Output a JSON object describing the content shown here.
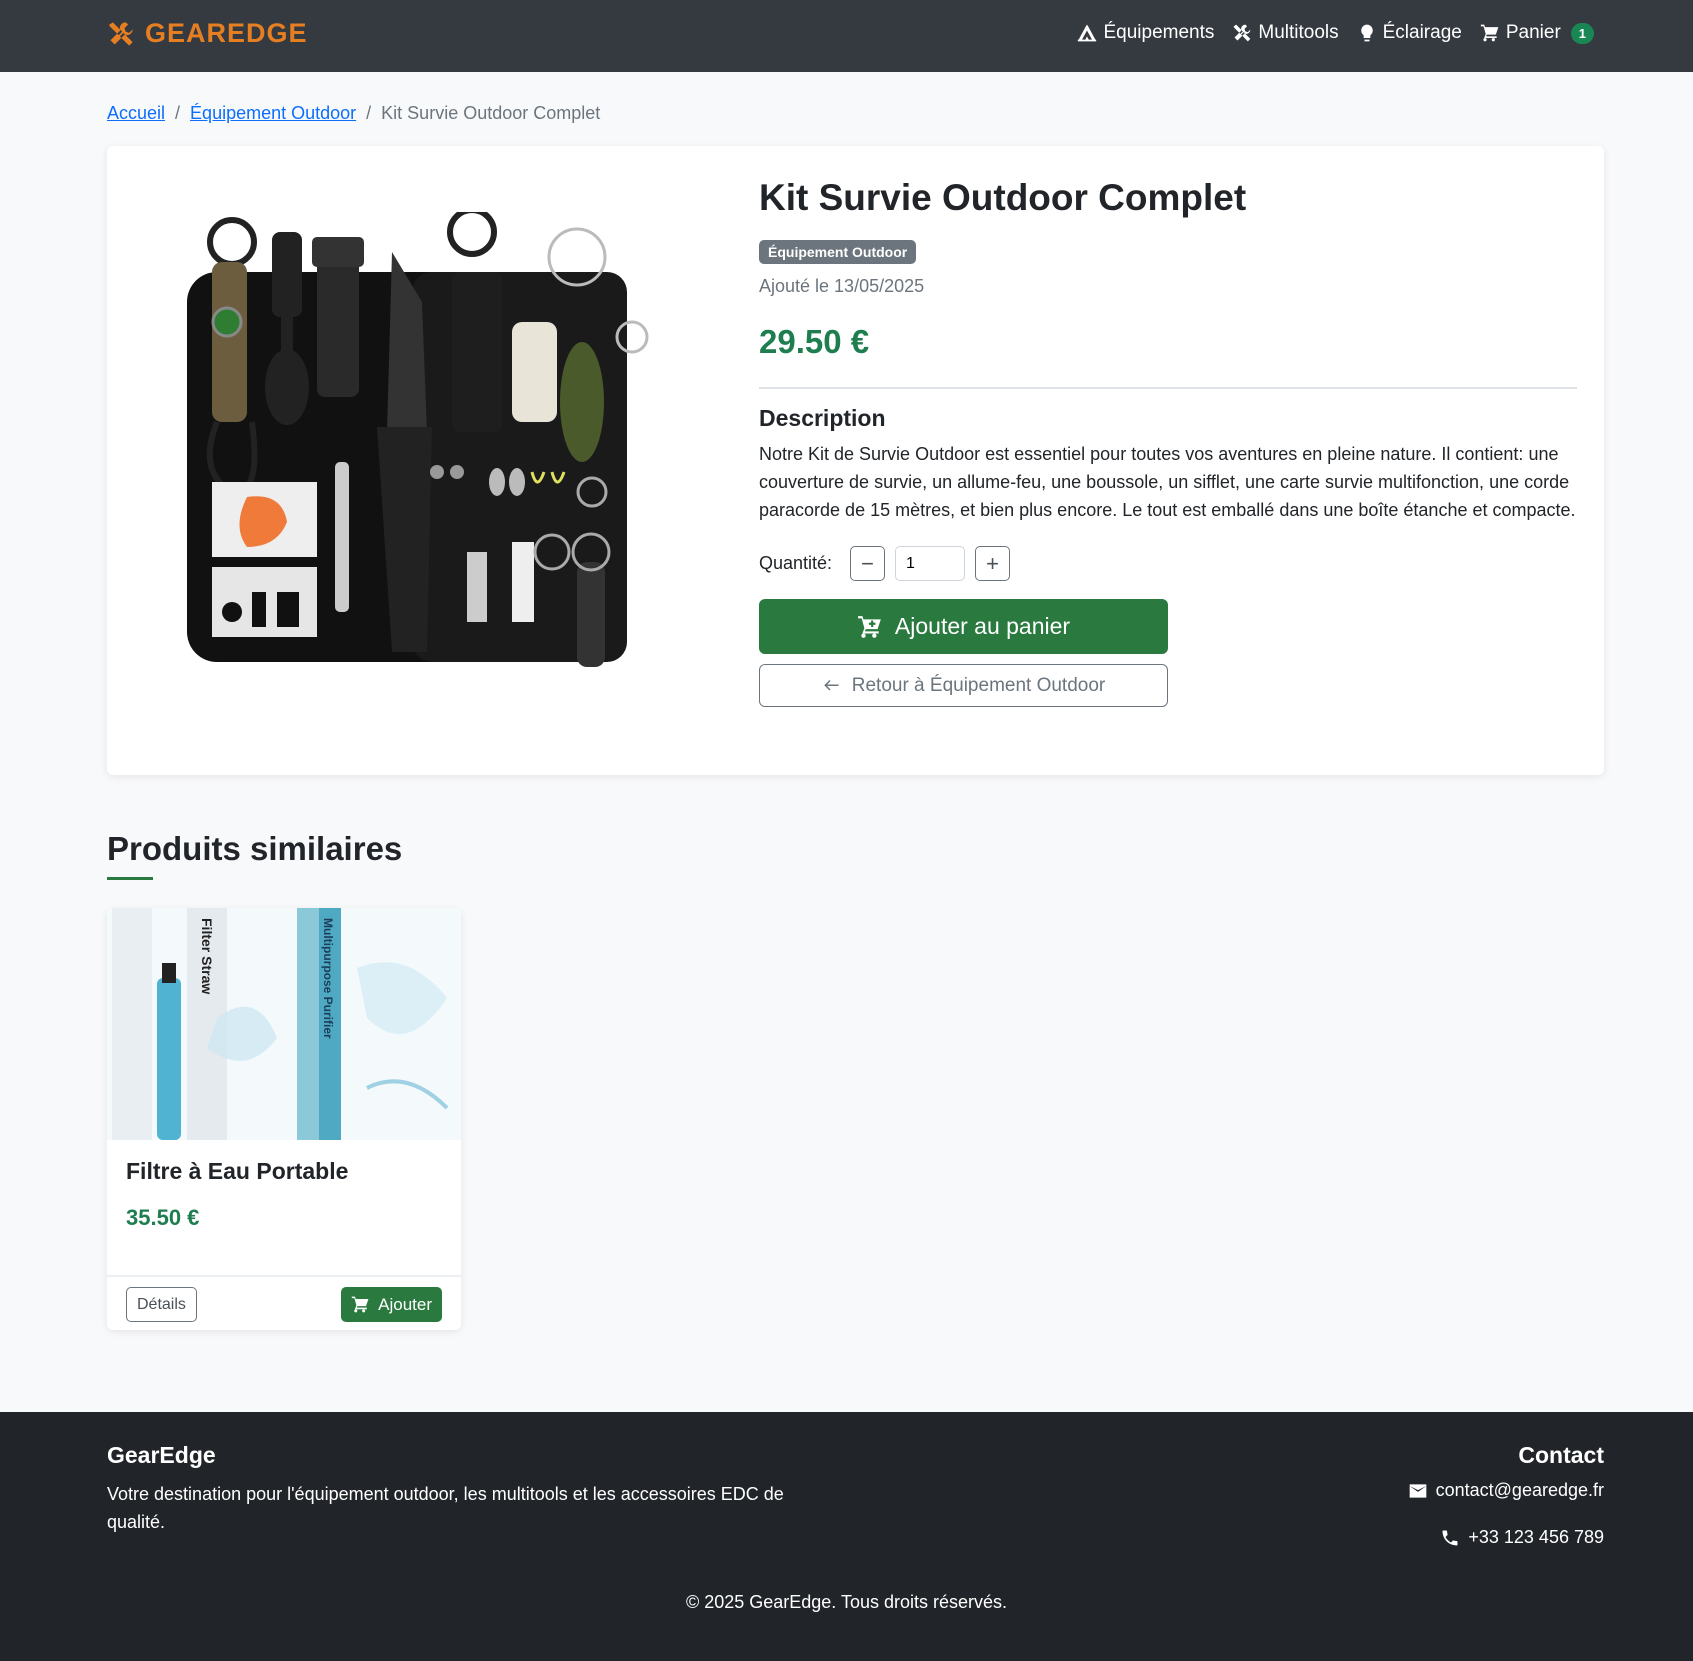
{
  "colors": {
    "navbar_bg": "#343a40",
    "brand": "#e67e22",
    "primary_green": "#2a7a3f",
    "price_green": "#1e7e4f",
    "footer_bg": "#212529",
    "link_blue": "#0d6efd"
  },
  "navbar": {
    "brand": "GEAREDGE",
    "brand_icon": "tools-icon",
    "links": [
      {
        "label": "Équipements",
        "icon": "campground-icon"
      },
      {
        "label": "Multitools",
        "icon": "tools-icon"
      },
      {
        "label": "Éclairage",
        "icon": "lightbulb-icon"
      },
      {
        "label": "Panier",
        "icon": "cart-icon"
      }
    ],
    "cart_count": "1"
  },
  "breadcrumb": {
    "home": "Accueil",
    "separator": "/",
    "category": "Équipement Outdoor",
    "current": "Kit Survie Outdoor Complet"
  },
  "product": {
    "title": "Kit Survie Outdoor Complet",
    "category_badge": "Équipement Outdoor",
    "added_date": "Ajouté le 13/05/2025",
    "price": "29.50 €",
    "description_title": "Description",
    "description": "Notre Kit de Survie Outdoor est essentiel pour toutes vos aventures en pleine nature. Il contient: une couverture de survie, un allume-feu, une boussole, un sifflet, une carte survie multifonction, une corde paracorde de 15 mètres, et bien plus encore. Le tout est emballé dans une boîte étanche et compacte.",
    "quantity_label": "Quantité:",
    "quantity_value": "1",
    "decrement_symbol": "−",
    "increment_symbol": "+",
    "add_to_cart": "Ajouter au panier",
    "back_label": "Retour à Équipement Outdoor"
  },
  "similar": {
    "title": "Produits similaires",
    "items": [
      {
        "name": "Filtre à Eau Portable",
        "price": "35.50 €",
        "details_label": "Détails",
        "add_label": "Ajouter",
        "image_text_1": "Filter Straw",
        "image_text_2": "Multipurpose Purifier"
      }
    ]
  },
  "footer": {
    "brand": "GearEdge",
    "tagline": "Votre destination pour l'équipement outdoor, les multitools et les accessoires EDC de qualité.",
    "contact_title": "Contact",
    "email": "contact@gearedge.fr",
    "phone": "+33 123 456 789",
    "copyright": "© 2025 GearEdge. Tous droits réservés."
  }
}
